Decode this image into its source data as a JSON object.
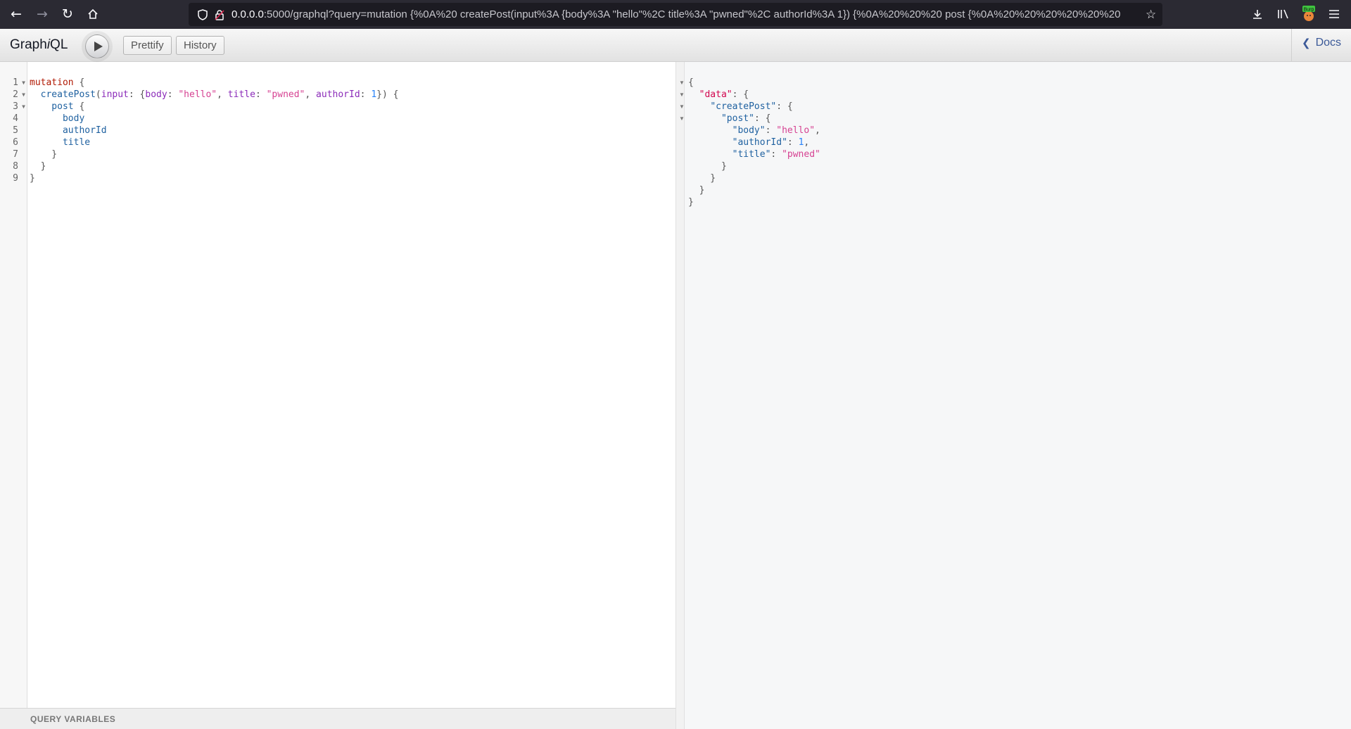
{
  "browser": {
    "url_host": "0.0.0.0",
    "url_rest": ":5000/graphql?query=mutation {%0A%20 createPost(input%3A {body%3A \"hello\"%2C title%3A \"pwned\"%2C authorId%3A 1}) {%0A%20%20%20 post {%0A%20%20%20%20%20%20",
    "extension_badge": "Burp",
    "icons": [
      "back-arrow-icon",
      "forward-arrow-icon",
      "reload-icon",
      "home-icon",
      "shield-icon",
      "lock-icon",
      "bookmark-star-icon",
      "download-icon",
      "library-icon",
      "burp-extension-icon",
      "hamburger-menu-icon"
    ]
  },
  "graphiql": {
    "title_pre": "Graph",
    "title_i": "i",
    "title_post": "QL",
    "prettify_label": "Prettify",
    "history_label": "History",
    "docs_label": "Docs",
    "query_variables_label": "QUERY VARIABLES"
  },
  "editor": {
    "line_numbers": [
      "1",
      "2",
      "3",
      "4",
      "5",
      "6",
      "7",
      "8",
      "9"
    ],
    "lines": [
      [
        "mutation",
        " {"
      ],
      [
        "  createPost",
        "(",
        "input",
        ": {",
        "body",
        ": ",
        "\"hello\"",
        ", ",
        "title",
        ": ",
        "\"pwned\"",
        ", ",
        "authorId",
        ": ",
        "1",
        "}) {"
      ],
      [
        "    post",
        " {"
      ],
      [
        "      body"
      ],
      [
        "      authorId"
      ],
      [
        "      title"
      ],
      [
        "    }"
      ],
      [
        "  }"
      ],
      [
        "}"
      ]
    ]
  },
  "result": {
    "lines": [
      "{",
      "  \"data\": {",
      "    \"createPost\": {",
      "      \"post\": {",
      "        \"body\": \"hello\",",
      "        \"authorId\": 1,",
      "        \"title\": \"pwned\"",
      "      }",
      "    }",
      "  }",
      "}"
    ],
    "key_data": "\"data\"",
    "key_createPost": "\"createPost\"",
    "key_post": "\"post\"",
    "key_body": "\"body\"",
    "val_body": "\"hello\"",
    "key_authorId": "\"authorId\"",
    "val_authorId": "1",
    "key_title": "\"title\"",
    "val_title": "\"pwned\""
  }
}
